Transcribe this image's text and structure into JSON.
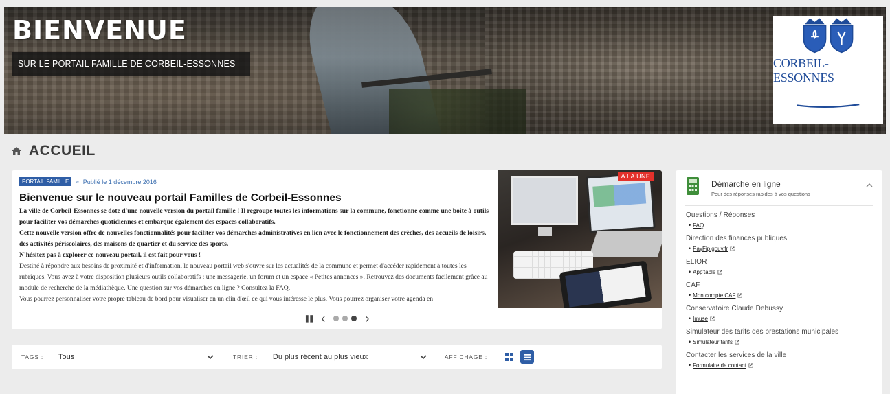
{
  "hero": {
    "title": "BIENVENUE",
    "subtitle": "SUR LE PORTAIL FAMILLE DE CORBEIL-ESSONNES",
    "logo_text": "CORBEIL-ESSONNES"
  },
  "page": {
    "title": "ACCUEIL"
  },
  "article": {
    "category": "PORTAIL FAMILLE",
    "separator": "»",
    "published": "Publié le 1 décembre 2016",
    "title": "Bienvenue sur le nouveau portail Familles de Corbeil-Essonnes",
    "lead_1": "La ville de Corbeil-Essonnes se dote d'une nouvelle version du portail famille ! Il regroupe toutes les informations sur la commune, fonctionne comme une boîte à outils pour faciliter vos démarches quotidiennes et embarque également des espaces collaboratifs.",
    "lead_2": "Cette nouvelle version offre de nouvelles fonctionnalités pour faciliter vos démarches administratives en lien avec le fonctionnement des crèches, des accueils de loisirs, des activités périscolaires, des maisons de quartier et du service des sports.",
    "lead_3": "N'hésitez pas à explorer ce nouveau portail, il est fait pour vous !",
    "body_1": "Destiné à répondre aux besoins de proximité et d'information, le nouveau portail web s'ouvre sur les actualités de la commune et permet d'accéder rapidement à toutes les rubriques. Vous avez à votre disposition plusieurs outils collaboratifs : une messagerie, un forum et un espace « Petites annonces ». Retrouvez des documents facilement grâce au module de recherche de la médiathèque. Une question sur vos démarches en ligne ? Consultez la FAQ.",
    "body_2": "Vous pourrez personnaliser votre propre tableau de bord pour visualiser en un clin d'œil ce qui vous intéresse le plus. Vous pourrez organiser votre agenda en",
    "image_badge": "A LA UNE"
  },
  "carousel": {
    "pause": "❚❚",
    "prev": "‹",
    "next": "›",
    "slides": 3,
    "active_slide": 3
  },
  "filters": {
    "tags_label": "TAGS :",
    "tags_value": "Tous",
    "sort_label": "TRIER :",
    "sort_value": "Du plus récent au plus vieux",
    "display_label": "AFFICHAGE :"
  },
  "sidebar": {
    "title": "Démarche en ligne",
    "subtitle": "Pour des réponses rapides à vos questions",
    "sections": [
      {
        "title": "Questions / Réponses",
        "link": "FAQ",
        "external": false
      },
      {
        "title": "Direction des finances publiques",
        "link": "PayFip.gouv.fr",
        "external": true
      },
      {
        "title": "ELIOR",
        "link": "App'table",
        "external": true
      },
      {
        "title": "CAF",
        "link": "Mon compte CAF",
        "external": true
      },
      {
        "title": "Conservatoire Claude Debussy",
        "link": "Imuse",
        "external": true
      },
      {
        "title": "Simulateur des tarifs des prestations municipales",
        "link": "Simulateur tarifs",
        "external": true
      },
      {
        "title": "Contacter les services de la ville",
        "link": "Formulaire de contact",
        "external": true
      }
    ]
  },
  "colors": {
    "accent": "#2f5ea6",
    "badge_red": "#e4312b",
    "logo_blue": "#1f4b99"
  }
}
